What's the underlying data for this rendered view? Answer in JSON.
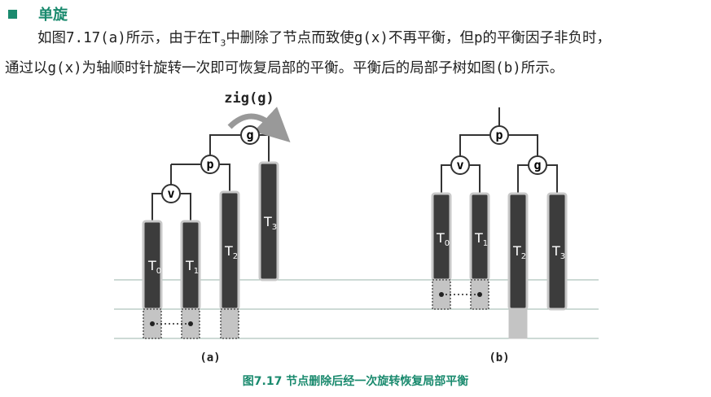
{
  "section": {
    "heading": "单旋"
  },
  "paragraph": {
    "l1_a": "如图",
    "l1_b": "7.17(a)",
    "l1_c": "所示，由于在",
    "l1_d": "T",
    "l1_e": "3",
    "l1_f": "中删除了节点而致使",
    "l1_g": "g(x)",
    "l1_h": "不再平衡，但",
    "l1_i": "p",
    "l1_j": "的平衡因子非负时，",
    "l2_a": "通过以",
    "l2_b": "g(x)",
    "l2_c": "为轴顺时针旋转一次即可恢复局部的平衡。平衡后的局部子树如图",
    "l2_d": "(b)",
    "l2_e": "所示。"
  },
  "figure": {
    "rotation_label": "zig(g)",
    "nodes": {
      "g": "g",
      "p": "p",
      "v": "v"
    },
    "subtrees": {
      "t0": "0",
      "t1": "1",
      "t2": "2",
      "t3": "3",
      "t": "T"
    },
    "panel_a_label": "(a)",
    "panel_b_label": "(b)",
    "colors": {
      "bar_fill": "#3c3c3c",
      "bar_border": "#c8c8c8",
      "dotted_fill": "#c4c4c4",
      "node_fill": "#ffffff",
      "line": "#333333",
      "arrow": "#999999",
      "baseline": "#9bb5ab"
    }
  },
  "caption": "图7.17  节点删除后经一次旋转恢复局部平衡"
}
